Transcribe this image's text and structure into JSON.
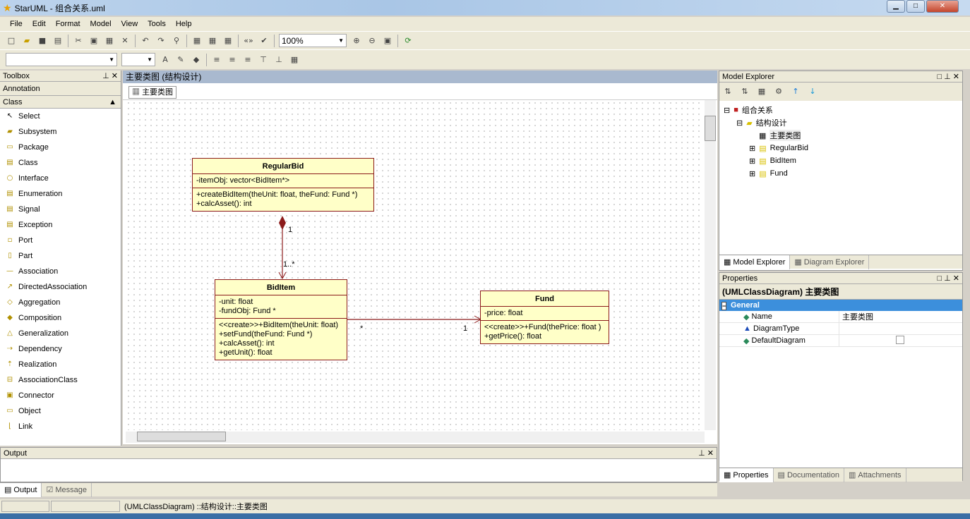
{
  "window": {
    "title": "StarUML - 组合关系.uml"
  },
  "menu": [
    "File",
    "Edit",
    "Format",
    "Model",
    "View",
    "Tools",
    "Help"
  ],
  "toolbar": {
    "zoom": "100%"
  },
  "toolbox": {
    "title": "Toolbox",
    "annotation": "Annotation",
    "category": "Class",
    "items": [
      "Select",
      "Subsystem",
      "Package",
      "Class",
      "Interface",
      "Enumeration",
      "Signal",
      "Exception",
      "Port",
      "Part",
      "Association",
      "DirectedAssociation",
      "Aggregation",
      "Composition",
      "Generalization",
      "Dependency",
      "Realization",
      "AssociationClass",
      "Connector",
      "Object",
      "Link"
    ]
  },
  "diagram": {
    "header": "主要类图 (结构设计)",
    "tab": "主要类图",
    "classes": [
      {
        "name": "RegularBid",
        "attrs": [
          "-itemObj: vector<BidItem*>"
        ],
        "ops": [
          "+createBidItem(theUnit: float, theFund: Fund *)",
          "+calcAsset(): int"
        ]
      },
      {
        "name": "BidItem",
        "attrs": [
          "-unit: float",
          "-fundObj: Fund *"
        ],
        "ops": [
          "<<create>>+BidItem(theUnit: float)",
          "+setFund(theFund: Fund *)",
          "+calcAsset(): int",
          "+getUnit(): float"
        ]
      },
      {
        "name": "Fund",
        "attrs": [
          "-price: float"
        ],
        "ops": [
          "<<create>>+Fund(thePrice: float )",
          "+getPrice(): float"
        ]
      }
    ],
    "relations": [
      {
        "type": "composition",
        "from": "RegularBid",
        "to": "BidItem",
        "from_mult": "1",
        "to_mult": "1..*"
      },
      {
        "type": "directed-association",
        "from": "BidItem",
        "to": "Fund",
        "from_mult": "*",
        "to_mult": "1"
      }
    ],
    "line_color": "#8b1a1a",
    "class_fill": "#ffffc8"
  },
  "explorer": {
    "title": "Model Explorer",
    "tree": [
      "组合关系",
      "结构设计",
      "主要类图",
      "RegularBid",
      "BidItem",
      "Fund"
    ],
    "tabs": [
      "Model Explorer",
      "Diagram Explorer"
    ]
  },
  "properties": {
    "title": "Properties",
    "header": "(UMLClassDiagram) 主要类图",
    "group": "General",
    "rows": [
      {
        "key": "Name",
        "value": "主要类图"
      },
      {
        "key": "DiagramType",
        "value": ""
      },
      {
        "key": "DefaultDiagram",
        "value": ""
      }
    ],
    "tabs": [
      "Properties",
      "Documentation",
      "Attachments"
    ]
  },
  "output": {
    "title": "Output",
    "tabs": [
      "Output",
      "Message"
    ]
  },
  "status": {
    "text": "(UMLClassDiagram) ::结构设计::主要类图"
  }
}
